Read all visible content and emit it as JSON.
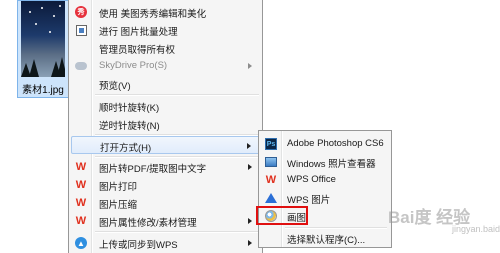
{
  "file": {
    "name": "素材1.jpg"
  },
  "context_menu": {
    "items": [
      {
        "label": "使用 美图秀秀编辑和美化",
        "icon": "meitu-icon"
      },
      {
        "label": "进行 图片批量处理",
        "icon": "batch-icon"
      },
      {
        "label": "管理员取得所有权",
        "icon": ""
      },
      {
        "label": "SkyDrive Pro(S)",
        "icon": "skydrive-icon",
        "disabled": true,
        "submenu": true
      },
      {
        "label": "预览(V)",
        "icon": ""
      },
      {
        "label": "顺时针旋转(K)",
        "icon": ""
      },
      {
        "label": "逆时针旋转(N)",
        "icon": ""
      },
      {
        "label": "打开方式(H)",
        "icon": "",
        "submenu": true,
        "highlighted": true
      },
      {
        "label": "图片转PDF/提取图中文字",
        "icon": "wps-icon",
        "submenu": true
      },
      {
        "label": "图片打印",
        "icon": "wps-icon"
      },
      {
        "label": "图片压缩",
        "icon": "wps-icon"
      },
      {
        "label": "图片属性修改/素材管理",
        "icon": "wps-icon",
        "submenu": true
      },
      {
        "label": "上传或同步到WPS",
        "icon": "upload-icon",
        "submenu": true
      }
    ]
  },
  "open_with_menu": {
    "items": [
      {
        "label": "Adobe Photoshop CS6",
        "icon": "photoshop-icon"
      },
      {
        "label": "Windows 照片查看器",
        "icon": "photo-viewer-icon"
      },
      {
        "label": "WPS Office",
        "icon": "wps-icon"
      },
      {
        "label": "WPS 图片",
        "icon": "wps-picture-icon"
      },
      {
        "label": "画图",
        "icon": "paint-icon",
        "outlined_in_red": true
      },
      {
        "label": "选择默认程序(C)...",
        "icon": ""
      }
    ]
  },
  "watermark": {
    "text": "Bai度 经验",
    "sub": "jingyan.baidu.com"
  },
  "colors": {
    "highlight_border": "#a8c8ee",
    "annotation_red": "#e01010",
    "wps_red": "#e0301e"
  }
}
